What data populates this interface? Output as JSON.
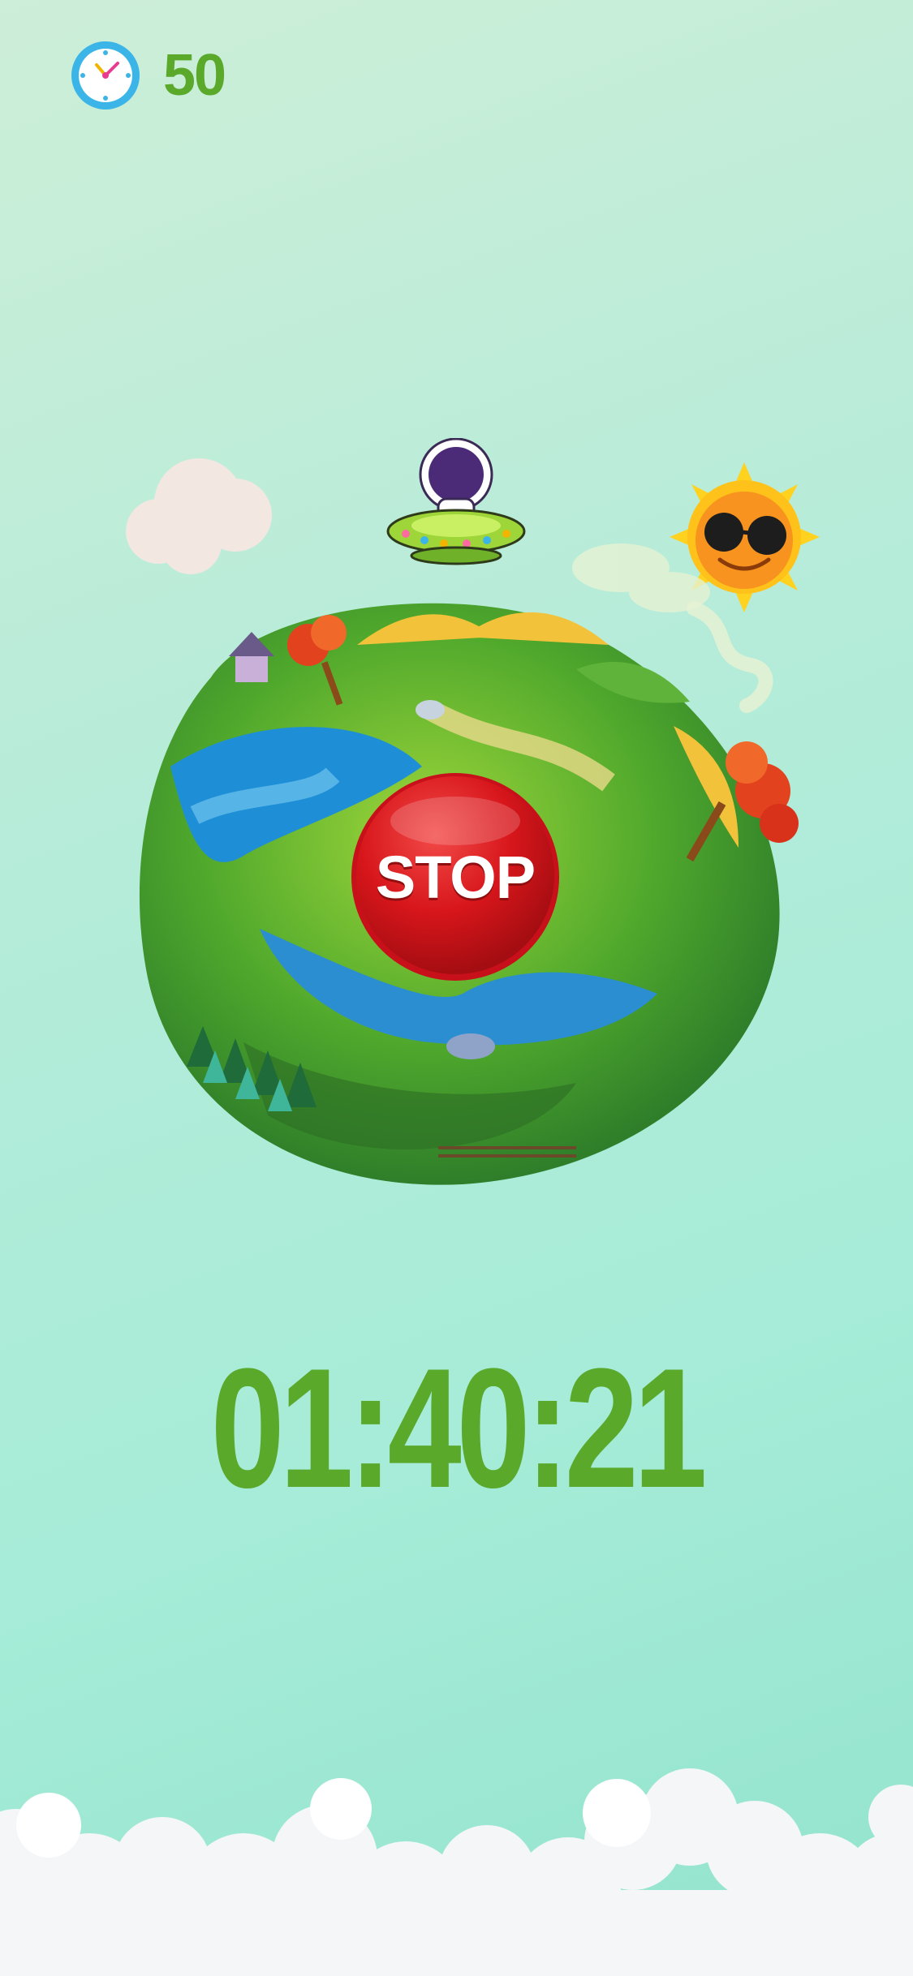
{
  "hud": {
    "score": "50",
    "clock_icon": "clock-icon"
  },
  "game": {
    "stop_label": "STOP",
    "timer": "01:40:21"
  },
  "scene": {
    "elements": [
      "cloud",
      "astronaut-ufo",
      "sun-with-sunglasses",
      "planet-island",
      "bottom-clouds"
    ]
  },
  "colors": {
    "accent_green": "#5aa92b",
    "button_red": "#d7161b",
    "sky": "#b4ecd9"
  }
}
